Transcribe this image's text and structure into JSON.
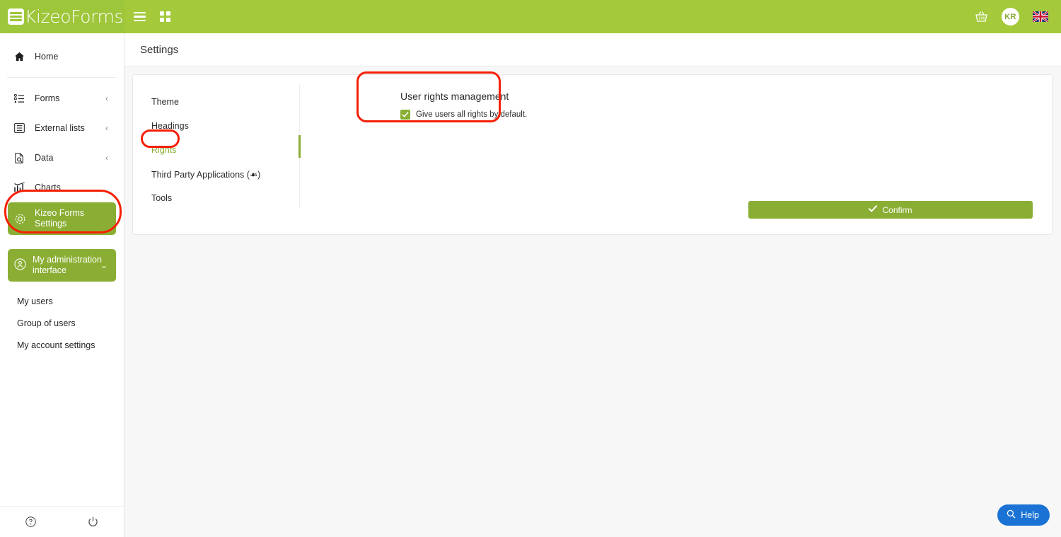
{
  "brand": {
    "name": "KizeoForms",
    "logo_icon": "list-logo-icon",
    "header_color": "#a4ca3c",
    "accent_green": "#8aae33",
    "annotation_color": "#f61f06",
    "help_blue": "#1a73d4"
  },
  "header": {
    "menu_icon": "hamburger-icon",
    "apps_icon": "grid-apps-icon",
    "basket_icon": "shopping-basket-icon",
    "avatar_initials": "KR",
    "flag_icon": "uk-flag-icon"
  },
  "sidebar": {
    "items": [
      {
        "label": "Home",
        "icon": "home-icon",
        "chevron": "",
        "active": false
      },
      {
        "label": "Forms",
        "icon": "forms-list-icon",
        "chevron": "‹",
        "active": false
      },
      {
        "label": "External lists",
        "icon": "external-lists-icon",
        "chevron": "‹",
        "active": false
      },
      {
        "label": "Data",
        "icon": "data-search-icon",
        "chevron": "‹",
        "active": false
      },
      {
        "label": "Charts",
        "icon": "bar-chart-icon",
        "chevron": "",
        "active": false
      }
    ],
    "settings_item": {
      "line1": "Kizeo Forms",
      "line2": "Settings",
      "icon": "gear-icon",
      "active": true
    },
    "admin": {
      "line1": "My administration",
      "line2": "interface",
      "icon": "user-circle-icon",
      "chevron": "⌄"
    },
    "sub_items": [
      {
        "label": "My users"
      },
      {
        "label": "Group of users"
      },
      {
        "label": "My account settings"
      }
    ],
    "footer": {
      "help_icon": "question-circle-icon",
      "power_icon": "power-logout-icon"
    }
  },
  "page": {
    "title": "Settings"
  },
  "settings_tabs": [
    {
      "label": "Theme",
      "selected": false
    },
    {
      "label": "Headings",
      "selected": false
    },
    {
      "label": "Rights",
      "selected": true
    },
    {
      "label": "Third Party Applications (☙)",
      "selected": false
    },
    {
      "label": "Tools",
      "selected": false
    }
  ],
  "rights_panel": {
    "title": "User rights management",
    "checkbox": {
      "label": "Give users all rights by default.",
      "checked": true,
      "check_glyph": "✓"
    }
  },
  "confirm": {
    "label": "Confirm",
    "icon": "check-icon",
    "glyph": "✔"
  },
  "help_widget": {
    "label": "Help",
    "icon": "search-icon"
  }
}
